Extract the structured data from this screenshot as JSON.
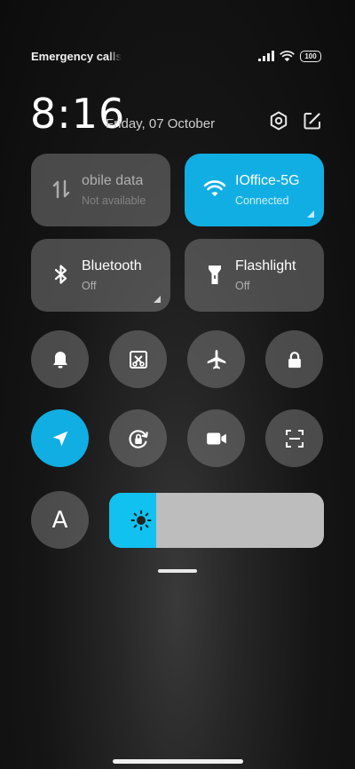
{
  "status": {
    "carrier_text": "Emergency calls o",
    "battery": "100"
  },
  "header": {
    "time": "8:16",
    "date": "Friday, 07 October"
  },
  "tiles": [
    {
      "title": "obile data",
      "subtitle": "Not available",
      "icon": "mobile-data-icon",
      "active": false
    },
    {
      "title": "IOffice-5G",
      "subtitle": "Connected",
      "icon": "wifi-icon",
      "active": true
    },
    {
      "title": "Bluetooth",
      "subtitle": "Off",
      "icon": "bluetooth-icon",
      "active": false
    },
    {
      "title": "Flashlight",
      "subtitle": "Off",
      "icon": "flashlight-icon",
      "active": false
    }
  ],
  "toggles_row1": [
    "bell-icon",
    "screenshot-icon",
    "airplane-icon",
    "lock-icon"
  ],
  "toggles_row2": [
    "location-icon",
    "rotation-lock-icon",
    "video-icon",
    "scan-icon"
  ],
  "auto_brightness_label": "A",
  "brightness_level": 0.22,
  "colors": {
    "accent": "#11aee3",
    "slider_fill": "#11c1f0",
    "tile_bg": "#6b6b6b"
  }
}
